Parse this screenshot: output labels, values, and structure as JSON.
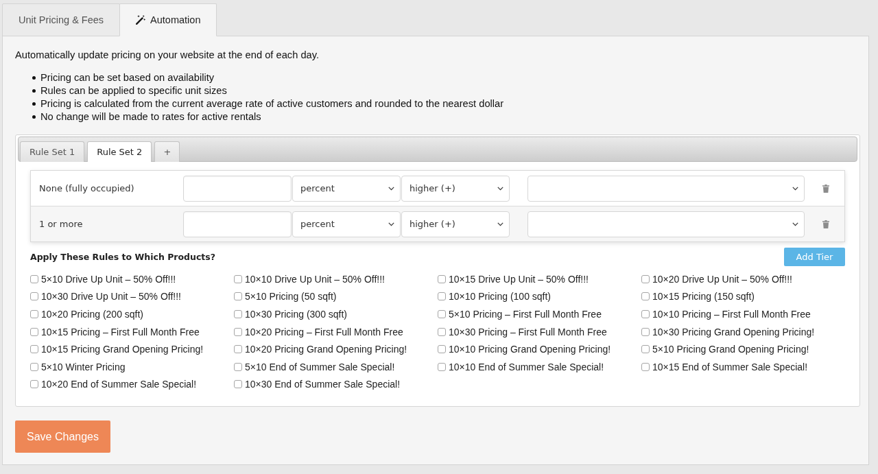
{
  "main_tabs": [
    {
      "label": "Unit Pricing & Fees",
      "selected": false,
      "has_icon": false
    },
    {
      "label": "Automation",
      "selected": true,
      "has_icon": true
    }
  ],
  "intro": "Automatically update pricing on your website at the end of each day.",
  "bullets": [
    "Pricing can be set based on availability",
    "Rules can be applied to specific unit sizes",
    "Pricing is calculated from the current average rate of active customers and rounded to the nearest dollar",
    "No change will be made to rates for active rentals"
  ],
  "rule_set_tabs": [
    {
      "kind": "tab",
      "label": "Rule Set 1",
      "selected": false
    },
    {
      "kind": "tab",
      "label": "Rule Set 2",
      "selected": true
    },
    {
      "kind": "add",
      "label": "+",
      "selected": false
    }
  ],
  "tiers": [
    {
      "label": "None (fully occupied)",
      "unit": "percent",
      "direction": "higher (+)"
    },
    {
      "label": "1 or more",
      "unit": "percent",
      "direction": "higher (+)"
    }
  ],
  "products_heading": "Apply These Rules to Which Products?",
  "add_tier_button": "Add Tier",
  "products": [
    {
      "label": "5×10 Drive Up Unit – 50% Off!!!",
      "checked": false
    },
    {
      "label": "10×10 Drive Up Unit – 50% Off!!!",
      "checked": false
    },
    {
      "label": "10×15 Drive Up Unit – 50% Off!!!",
      "checked": false
    },
    {
      "label": "10×20 Drive Up Unit – 50% Off!!!",
      "checked": false
    },
    {
      "label": "10×30 Drive Up Unit – 50% Off!!!",
      "checked": false
    },
    {
      "label": "5×10 Pricing (50 sqft)",
      "checked": false
    },
    {
      "label": "10×10 Pricing (100 sqft)",
      "checked": false
    },
    {
      "label": "10×15 Pricing (150 sqft)",
      "checked": false
    },
    {
      "label": "10×20 Pricing (200 sqft)",
      "checked": false
    },
    {
      "label": "10×30 Pricing (300 sqft)",
      "checked": false
    },
    {
      "label": "5×10 Pricing – First Full Month Free",
      "checked": false
    },
    {
      "label": "10×10 Pricing – First Full Month Free",
      "checked": false
    },
    {
      "label": "10×15 Pricing – First Full Month Free",
      "checked": false
    },
    {
      "label": "10×20 Pricing – First Full Month Free",
      "checked": false
    },
    {
      "label": "10×30 Pricing – First Full Month Free",
      "checked": false
    },
    {
      "label": "10×30 Pricing Grand Opening Pricing!",
      "checked": false
    },
    {
      "label": "10×15 Pricing Grand Opening Pricing!",
      "checked": false
    },
    {
      "label": "10×20 Pricing Grand Opening Pricing!",
      "checked": false
    },
    {
      "label": "10×10 Pricing Grand Opening Pricing!",
      "checked": false
    },
    {
      "label": "5×10 Pricing Grand Opening Pricing!",
      "checked": false
    },
    {
      "label": "5×10 Winter Pricing",
      "checked": false
    },
    {
      "label": "5×10 End of Summer Sale Special!",
      "checked": false
    },
    {
      "label": "10×10 End of Summer Sale Special!",
      "checked": false
    },
    {
      "label": "10×15 End of Summer Sale Special!",
      "checked": false
    },
    {
      "label": "10×20 End of Summer Sale Special!",
      "checked": false
    },
    {
      "label": "10×30 End of Summer Sale Special!",
      "checked": false
    }
  ],
  "save_button": "Save Changes"
}
